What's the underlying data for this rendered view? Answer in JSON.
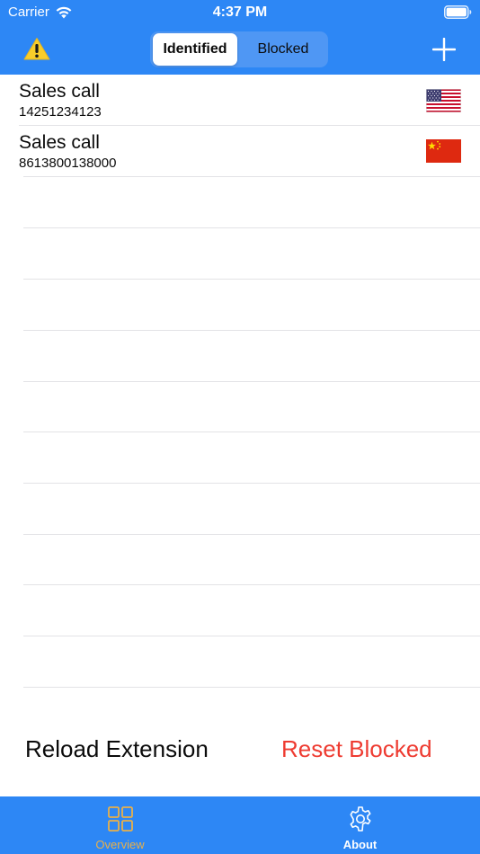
{
  "colors": {
    "brand_blue": "#2d87f5",
    "segment_bg": "#4f97f4",
    "destructive": "#ee3b31",
    "tab_selected": "#e8b04a",
    "tab_unselected": "#ffffff"
  },
  "status_bar": {
    "carrier": "Carrier",
    "time": "4:37 PM",
    "icons": [
      "wifi-icon",
      "battery-icon"
    ]
  },
  "navbar": {
    "left_icon": "warning-icon",
    "segments": [
      {
        "label": "Identified",
        "selected": true
      },
      {
        "label": "Blocked",
        "selected": false
      }
    ],
    "right_icon": "plus-icon"
  },
  "entries": [
    {
      "name": "Sales call",
      "number": "14251234123",
      "flag": "us-flag-icon"
    },
    {
      "name": "Sales call",
      "number": "8613800138000",
      "flag": "cn-flag-icon"
    }
  ],
  "actions": {
    "reload": "Reload Extension",
    "reset": "Reset Blocked"
  },
  "tabbar": {
    "tabs": [
      {
        "label": "Overview",
        "icon": "grid-icon",
        "selected": true
      },
      {
        "label": "About",
        "icon": "gear-icon",
        "selected": false
      }
    ]
  }
}
